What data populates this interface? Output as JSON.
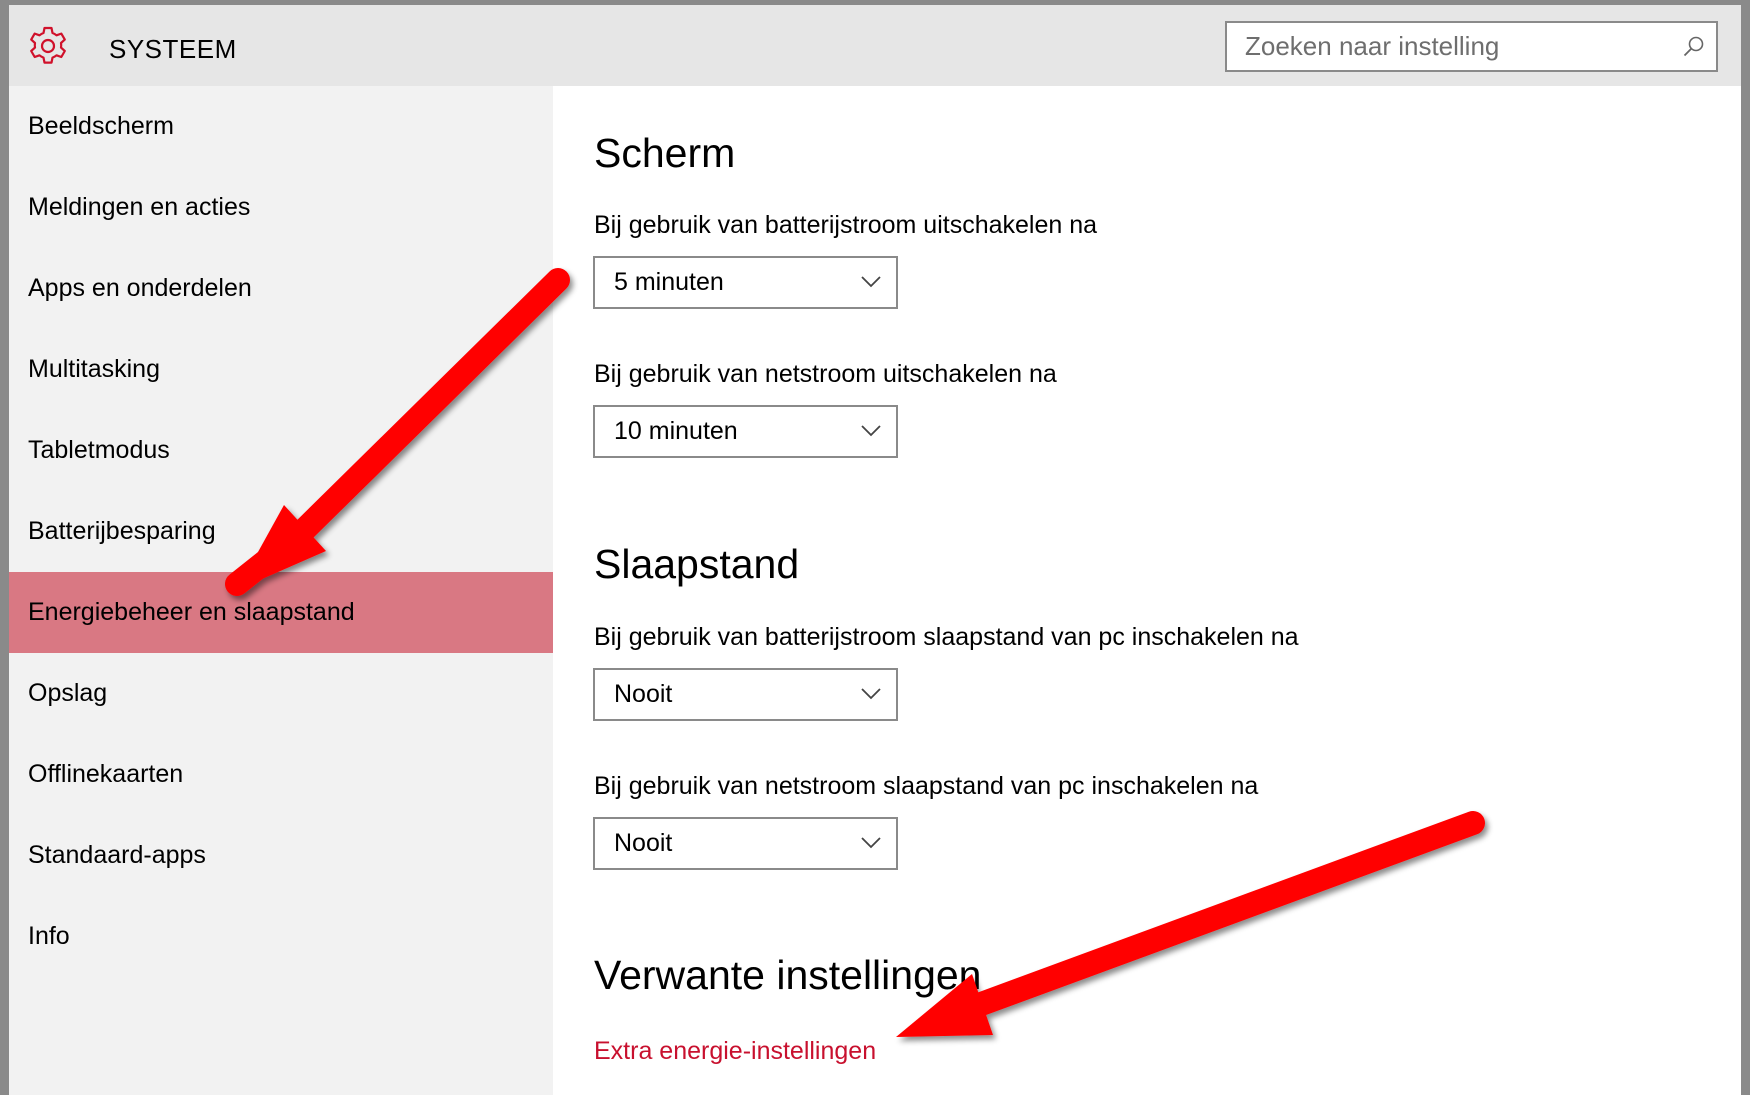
{
  "header": {
    "app_icon": "gear-icon",
    "title": "SYSTEEM",
    "search_placeholder": "Zoeken naar instelling",
    "search_icon": "search-icon"
  },
  "sidebar": {
    "items": [
      {
        "label": "Beeldscherm"
      },
      {
        "label": "Meldingen en acties"
      },
      {
        "label": "Apps en onderdelen"
      },
      {
        "label": "Multitasking"
      },
      {
        "label": "Tabletmodus"
      },
      {
        "label": "Batterijbesparing"
      },
      {
        "label": "Energiebeheer en slaapstand",
        "selected": true
      },
      {
        "label": "Opslag"
      },
      {
        "label": "Offlinekaarten"
      },
      {
        "label": "Standaard-apps"
      },
      {
        "label": "Info"
      }
    ]
  },
  "main": {
    "screen": {
      "title": "Scherm",
      "battery_label": "Bij gebruik van batterijstroom uitschakelen na",
      "battery_value": "5 minuten",
      "ac_label": "Bij gebruik van netstroom uitschakelen na",
      "ac_value": "10 minuten"
    },
    "sleep": {
      "title": "Slaapstand",
      "battery_label": "Bij gebruik van batterijstroom slaapstand van pc inschakelen na",
      "battery_value": "Nooit",
      "ac_label": "Bij gebruik van netstroom slaapstand van pc inschakelen na",
      "ac_value": "Nooit"
    },
    "related": {
      "title": "Verwante instellingen",
      "link": "Extra energie-instellingen"
    }
  },
  "colors": {
    "accent": "#c8102e",
    "selected_bg": "#d97883",
    "annotation_arrow": "#ff0000"
  }
}
